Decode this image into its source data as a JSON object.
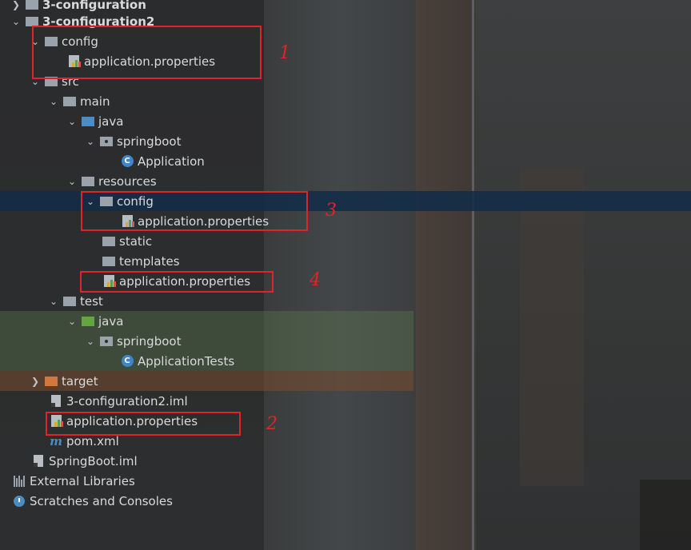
{
  "tree": {
    "rows": [
      {
        "label": "3-configuration",
        "icon": "module-folder-icon"
      },
      {
        "label": "3-configuration2",
        "icon": "module-folder-icon"
      },
      {
        "label": "config",
        "icon": "folder-icon"
      },
      {
        "label": "application.properties",
        "icon": "properties-file-icon"
      },
      {
        "label": "src",
        "icon": "folder-icon"
      },
      {
        "label": "main",
        "icon": "folder-icon"
      },
      {
        "label": "java",
        "icon": "source-folder-icon"
      },
      {
        "label": "springboot",
        "icon": "package-icon"
      },
      {
        "label": "Application",
        "icon": "spring-class-icon"
      },
      {
        "label": "resources",
        "icon": "resources-folder-icon"
      },
      {
        "label": "config",
        "icon": "folder-icon"
      },
      {
        "label": "application.properties",
        "icon": "properties-file-icon"
      },
      {
        "label": "static",
        "icon": "folder-icon"
      },
      {
        "label": "templates",
        "icon": "folder-icon"
      },
      {
        "label": "application.properties",
        "icon": "properties-file-icon"
      },
      {
        "label": "test",
        "icon": "folder-icon"
      },
      {
        "label": "java",
        "icon": "test-source-folder-icon"
      },
      {
        "label": "springboot",
        "icon": "package-icon"
      },
      {
        "label": "ApplicationTests",
        "icon": "class-icon"
      },
      {
        "label": "target",
        "icon": "excluded-folder-icon"
      },
      {
        "label": "3-configuration2.iml",
        "icon": "iml-file-icon"
      },
      {
        "label": "application.properties",
        "icon": "properties-file-icon"
      },
      {
        "label": "pom.xml",
        "icon": "maven-icon"
      },
      {
        "label": "SpringBoot.iml",
        "icon": "iml-file-icon"
      },
      {
        "label": "External Libraries",
        "icon": "libraries-icon"
      },
      {
        "label": "Scratches and Consoles",
        "icon": "scratches-icon"
      }
    ]
  },
  "annotations": {
    "n1": "1",
    "n2": "2",
    "n3": "3",
    "n4": "4"
  },
  "colors": {
    "highlight": "#e0242a",
    "selection": "#122c48",
    "source_folder": "#4c8cc0",
    "test_folder": "#62a542",
    "excluded_folder": "#d0783e"
  }
}
